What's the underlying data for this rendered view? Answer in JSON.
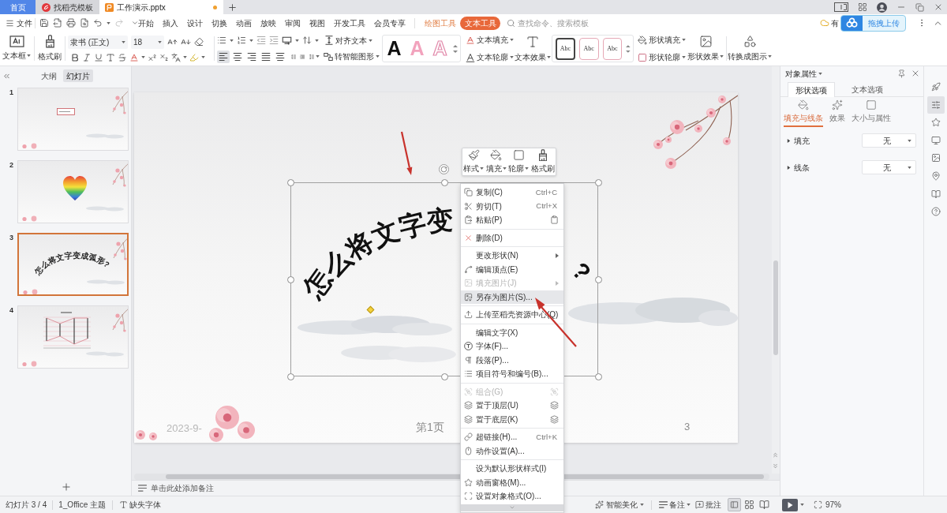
{
  "tabbar": {
    "tabs": [
      {
        "label": "首页",
        "kind": "home",
        "selected": false,
        "unsaved": false
      },
      {
        "label": "找稻壳模板",
        "kind": "template",
        "selected": false,
        "unsaved": false
      },
      {
        "label": "工作演示.pptx",
        "kind": "document",
        "selected": true,
        "unsaved": true
      }
    ]
  },
  "menu_bar": {
    "file": "文件",
    "tabs": [
      {
        "label": "开始",
        "kind": "main",
        "selected": false
      },
      {
        "label": "插入",
        "kind": "main",
        "selected": false
      },
      {
        "label": "设计",
        "kind": "main",
        "selected": false
      },
      {
        "label": "切换",
        "kind": "main",
        "selected": false
      },
      {
        "label": "动画",
        "kind": "main",
        "selected": false
      },
      {
        "label": "放映",
        "kind": "main",
        "selected": false
      },
      {
        "label": "审阅",
        "kind": "main",
        "selected": false
      },
      {
        "label": "视图",
        "kind": "main",
        "selected": false
      },
      {
        "label": "开发工具",
        "kind": "main",
        "selected": false
      },
      {
        "label": "会员专享",
        "kind": "main",
        "selected": false
      },
      {
        "label": "绘图工具",
        "kind": "tool",
        "selected": false
      },
      {
        "label": "文本工具",
        "kind": "tool",
        "selected": true
      }
    ],
    "search": {
      "placeholder": "查找命令、搜索模板"
    },
    "cloud_status": "有",
    "upload": "拖拽上传"
  },
  "ribbon": {
    "text_box": "文本框",
    "format_painter": "格式刷",
    "font_name": "隶书 (正文)",
    "font_size": "18",
    "alignment": [
      {
        "kind": "left",
        "selected": true
      },
      {
        "kind": "center",
        "selected": false
      },
      {
        "kind": "right",
        "selected": false
      },
      {
        "kind": "justify",
        "selected": false
      },
      {
        "kind": "distributed",
        "selected": false
      }
    ],
    "align_text": "对齐文本",
    "smart_graphic": "转智能图形",
    "wordart": [
      {
        "sample": "A",
        "kind": "solid"
      },
      {
        "sample": "A",
        "kind": "pink"
      },
      {
        "sample": "A",
        "kind": "outline"
      }
    ],
    "text_fill": "文本填充",
    "text_outline": "文本轮廓",
    "text_effects": "文本效果",
    "shape_styles": [
      {
        "sample": "Abc",
        "kind": "dark"
      },
      {
        "sample": "Abc",
        "kind": "pink"
      },
      {
        "sample": "Abc",
        "kind": "pink"
      }
    ],
    "shape_fill": "形状填充",
    "shape_outline": "形状轮廓",
    "shape_effects": "形状效果",
    "convert": "转换成图示"
  },
  "slides_panel": {
    "tabs": [
      {
        "label": "大纲",
        "selected": false
      },
      {
        "label": "幻灯片",
        "selected": true
      }
    ],
    "thumbnails": [
      {
        "number": "1",
        "kind": "title",
        "selected": false
      },
      {
        "number": "2",
        "kind": "heart",
        "selected": false
      },
      {
        "number": "3",
        "kind": "arc",
        "title": "怎么将文字变成弧形?",
        "selected": true
      },
      {
        "number": "4",
        "kind": "chart",
        "selected": false
      }
    ]
  },
  "slide": {
    "arc_text": "怎么将文字变",
    "arc_tail": "?",
    "date": "2023-9-",
    "page_label": "第1页",
    "number": "3"
  },
  "notes": {
    "placeholder": "单击此处添加备注"
  },
  "mini_toolbar": [
    {
      "label": "样式",
      "kind": "brush",
      "dropdown": true
    },
    {
      "label": "填充",
      "kind": "fill",
      "dropdown": true
    },
    {
      "label": "轮廓",
      "kind": "outline",
      "dropdown": true
    },
    {
      "label": "格式刷",
      "kind": "painter",
      "dropdown": false
    }
  ],
  "context_menu": {
    "groups": [
      [
        {
          "label": "复制(C)",
          "kind": "copy",
          "shortcut": "Ctrl+C",
          "side_icon": false,
          "submenu": false,
          "disabled": false,
          "selected": false
        },
        {
          "label": "剪切(T)",
          "kind": "cut",
          "shortcut": "Ctrl+X",
          "side_icon": false,
          "submenu": false,
          "disabled": false,
          "selected": false
        },
        {
          "label": "粘贴(P)",
          "kind": "paste",
          "side_icon": true,
          "submenu": false,
          "disabled": false,
          "selected": false
        }
      ],
      [
        {
          "label": "删除(D)",
          "kind": "delete",
          "side_icon": false,
          "submenu": false,
          "disabled": false,
          "selected": false
        }
      ],
      [
        {
          "label": "更改形状(N)",
          "kind": "plain",
          "side_icon": false,
          "submenu": true,
          "disabled": false,
          "selected": false
        },
        {
          "label": "编辑顶点(E)",
          "kind": "edit-points",
          "side_icon": false,
          "submenu": false,
          "disabled": false,
          "selected": false
        },
        {
          "label": "填充图片(J)",
          "kind": "fill-picture",
          "side_icon": false,
          "submenu": true,
          "disabled": true,
          "selected": false
        },
        {
          "label": "另存为图片(S)...",
          "kind": "save-picture",
          "side_icon": false,
          "submenu": false,
          "disabled": false,
          "selected": true
        }
      ],
      [
        {
          "label": "上传至稻壳资源中心(Q)",
          "kind": "upload",
          "side_icon": false,
          "submenu": false,
          "disabled": false,
          "selected": false
        }
      ],
      [
        {
          "label": "编辑文字(X)",
          "kind": "plain",
          "side_icon": false,
          "submenu": false,
          "disabled": false,
          "selected": false
        },
        {
          "label": "字体(F)...",
          "kind": "font",
          "side_icon": false,
          "submenu": false,
          "disabled": false,
          "selected": false
        },
        {
          "label": "段落(P)...",
          "kind": "paragraph",
          "side_icon": false,
          "submenu": false,
          "disabled": false,
          "selected": false
        },
        {
          "label": "项目符号和编号(B)...",
          "kind": "bullets",
          "side_icon": false,
          "submenu": false,
          "disabled": false,
          "selected": false
        }
      ],
      [
        {
          "label": "组合(G)",
          "kind": "group",
          "side_icon": true,
          "submenu": false,
          "disabled": true,
          "selected": false
        },
        {
          "label": "置于顶层(U)",
          "kind": "front",
          "side_icon": true,
          "submenu": false,
          "disabled": false,
          "selected": false
        },
        {
          "label": "置于底层(K)",
          "kind": "back",
          "side_icon": true,
          "submenu": false,
          "disabled": false,
          "selected": false
        }
      ],
      [
        {
          "label": "超链接(H)...",
          "kind": "link",
          "shortcut": "Ctrl+K",
          "side_icon": false,
          "submenu": false,
          "disabled": false,
          "selected": false
        },
        {
          "label": "动作设置(A)...",
          "kind": "action",
          "side_icon": false,
          "submenu": false,
          "disabled": false,
          "selected": false
        }
      ],
      [
        {
          "label": "设为默认形状样式(I)",
          "kind": "plain",
          "side_icon": false,
          "submenu": false,
          "disabled": false,
          "selected": false
        },
        {
          "label": "动画窗格(M)...",
          "kind": "animation",
          "side_icon": false,
          "submenu": false,
          "disabled": false,
          "selected": false
        },
        {
          "label": "设置对象格式(O)...",
          "kind": "format",
          "side_icon": false,
          "submenu": false,
          "disabled": false,
          "selected": false
        }
      ]
    ]
  },
  "properties": {
    "title": "对象属性",
    "tabs": [
      {
        "label": "形状选项",
        "selected": true
      },
      {
        "label": "文本选项",
        "selected": false
      }
    ],
    "subtabs": [
      {
        "label": "填充与线条",
        "kind": "fill-line",
        "selected": true
      },
      {
        "label": "效果",
        "kind": "effects",
        "selected": false
      },
      {
        "label": "大小与属性",
        "kind": "size",
        "selected": false
      }
    ],
    "sections": [
      {
        "label": "填充",
        "value": "无",
        "expanded": false
      },
      {
        "label": "线条",
        "value": "无",
        "expanded": false
      }
    ]
  },
  "side_rail": [
    {
      "kind": "rocket",
      "selected": false
    },
    {
      "kind": "sliders",
      "selected": true
    },
    {
      "kind": "star",
      "selected": false
    },
    {
      "kind": "monitor",
      "selected": false
    },
    {
      "kind": "image",
      "selected": false
    },
    {
      "kind": "pin",
      "selected": false
    },
    {
      "kind": "book",
      "selected": false
    },
    {
      "kind": "help",
      "selected": false
    }
  ],
  "status_bar": {
    "slide_counter": "幻灯片 3 / 4",
    "theme": "1_Office 主题",
    "missing_fonts": "缺失字体",
    "beautify": "智能美化",
    "notes": "备注",
    "comments": "批注",
    "views": [
      {
        "kind": "normal",
        "selected": true
      },
      {
        "kind": "sorter",
        "selected": false
      },
      {
        "kind": "reading",
        "selected": false
      }
    ],
    "zoom": "97%"
  }
}
